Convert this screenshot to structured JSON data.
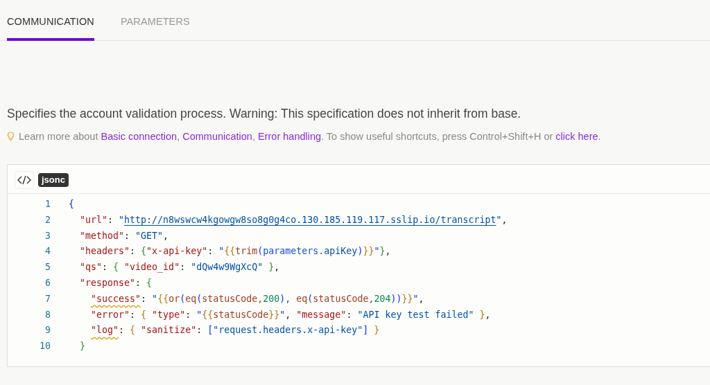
{
  "tabs": [
    {
      "label": "COMMUNICATION",
      "selected": true
    },
    {
      "label": "PARAMETERS",
      "selected": false
    }
  ],
  "description": "Specifies the account validation process. Warning: This specification does not inherit from base.",
  "tip": [
    {
      "kind": "text",
      "text": "Learn more about "
    },
    {
      "kind": "link",
      "text": "Basic connection"
    },
    {
      "kind": "text",
      "text": ", "
    },
    {
      "kind": "link",
      "text": "Communication"
    },
    {
      "kind": "text",
      "text": ", "
    },
    {
      "kind": "link",
      "text": "Error handling"
    },
    {
      "kind": "text",
      "text": ". To show useful shortcuts, press Control+Shift+H or "
    },
    {
      "kind": "link",
      "text": "click here"
    },
    {
      "kind": "text",
      "text": "."
    }
  ],
  "editor": {
    "language": "jsonc",
    "lines": [
      {
        "number": "1",
        "tokens": [
          {
            "kind": "b1",
            "text": "{"
          }
        ]
      },
      {
        "number": "2",
        "tokens": [
          {
            "kind": "key",
            "text": "  \"url\""
          },
          {
            "kind": "p",
            "text": ": "
          },
          {
            "kind": "str",
            "text": "\""
          },
          {
            "kind": "link",
            "text": "http://n8wswcw4kgowgw8so8g0g4co.130.185.119.117.sslip.io/transcript"
          },
          {
            "kind": "str",
            "text": "\""
          },
          {
            "kind": "p",
            "text": ","
          }
        ]
      },
      {
        "number": "3",
        "tokens": [
          {
            "kind": "key",
            "text": "  \"method\""
          },
          {
            "kind": "p",
            "text": ": "
          },
          {
            "kind": "str",
            "text": "\"GET\""
          },
          {
            "kind": "p",
            "text": ","
          }
        ]
      },
      {
        "number": "4",
        "tokens": [
          {
            "kind": "key",
            "text": "  \"headers\""
          },
          {
            "kind": "p",
            "text": ": "
          },
          {
            "kind": "b2",
            "text": "{"
          },
          {
            "kind": "key",
            "text": "\"x-api-key\""
          },
          {
            "kind": "p",
            "text": ": "
          },
          {
            "kind": "str",
            "text": "\""
          },
          {
            "kind": "b3",
            "text": "{{"
          },
          {
            "kind": "fn",
            "text": "trim"
          },
          {
            "kind": "b1",
            "text": "("
          },
          {
            "kind": "var",
            "text": "parameters"
          },
          {
            "kind": "str",
            "text": ".apiKey"
          },
          {
            "kind": "b1",
            "text": ")"
          },
          {
            "kind": "b3",
            "text": "}}"
          },
          {
            "kind": "str",
            "text": "\""
          },
          {
            "kind": "b2",
            "text": "}"
          },
          {
            "kind": "p",
            "text": ","
          }
        ]
      },
      {
        "number": "5",
        "tokens": [
          {
            "kind": "key",
            "text": "  \"qs\""
          },
          {
            "kind": "p",
            "text": ": "
          },
          {
            "kind": "b2",
            "text": "{ "
          },
          {
            "kind": "key",
            "text": "\"video_id\""
          },
          {
            "kind": "p",
            "text": ": "
          },
          {
            "kind": "str",
            "text": "\"dQw4w9WgXcQ\" "
          },
          {
            "kind": "b2",
            "text": "}"
          },
          {
            "kind": "p",
            "text": ","
          }
        ]
      },
      {
        "number": "6",
        "tokens": [
          {
            "kind": "key",
            "text": "  \"response\""
          },
          {
            "kind": "p",
            "text": ": "
          },
          {
            "kind": "b2",
            "text": "{"
          }
        ]
      },
      {
        "number": "7",
        "tokens": [
          {
            "kind": "key",
            "text": "    \"success\"",
            "warning": true
          },
          {
            "kind": "p",
            "text": ": "
          },
          {
            "kind": "str",
            "text": "\""
          },
          {
            "kind": "b3",
            "text": "{{"
          },
          {
            "kind": "fn",
            "text": "or"
          },
          {
            "kind": "b1",
            "text": "("
          },
          {
            "kind": "fn",
            "text": "eq"
          },
          {
            "kind": "b1",
            "text": "("
          },
          {
            "kind": "fn",
            "text": "statusCode,"
          },
          {
            "kind": "num",
            "text": "200"
          },
          {
            "kind": "b1",
            "text": ")"
          },
          {
            "kind": "str",
            "text": ", "
          },
          {
            "kind": "fn",
            "text": "eq"
          },
          {
            "kind": "b1",
            "text": "("
          },
          {
            "kind": "fn",
            "text": "statusCode,"
          },
          {
            "kind": "num",
            "text": "204"
          },
          {
            "kind": "b1",
            "text": "))"
          },
          {
            "kind": "b3",
            "text": "}}"
          },
          {
            "kind": "str",
            "text": "\""
          },
          {
            "kind": "p",
            "text": ","
          }
        ]
      },
      {
        "number": "8",
        "tokens": [
          {
            "kind": "key",
            "text": "    \"error\""
          },
          {
            "kind": "p",
            "text": ": "
          },
          {
            "kind": "b3",
            "text": "{ "
          },
          {
            "kind": "key",
            "text": "\"type\""
          },
          {
            "kind": "p",
            "text": ": "
          },
          {
            "kind": "str",
            "text": "\""
          },
          {
            "kind": "b3",
            "text": "{{"
          },
          {
            "kind": "fn",
            "text": "statusCode"
          },
          {
            "kind": "b3",
            "text": "}}"
          },
          {
            "kind": "str",
            "text": "\""
          },
          {
            "kind": "p",
            "text": ", "
          },
          {
            "kind": "key",
            "text": "\"message\""
          },
          {
            "kind": "p",
            "text": ": "
          },
          {
            "kind": "str",
            "text": "\"API key test failed\" "
          },
          {
            "kind": "b3",
            "text": "}"
          },
          {
            "kind": "p",
            "text": ","
          }
        ]
      },
      {
        "number": "9",
        "tokens": [
          {
            "kind": "key",
            "text": "    \"log\"",
            "warning": true
          },
          {
            "kind": "p",
            "text": ": "
          },
          {
            "kind": "b3",
            "text": "{ "
          },
          {
            "kind": "key",
            "text": "\"sanitize\""
          },
          {
            "kind": "p",
            "text": ": "
          },
          {
            "kind": "b4",
            "text": "["
          },
          {
            "kind": "str",
            "text": "\"request.headers.x-api-key\""
          },
          {
            "kind": "b4",
            "text": "] "
          },
          {
            "kind": "b3",
            "text": "}"
          }
        ]
      },
      {
        "number": "10",
        "tokens": [
          {
            "kind": "b2",
            "text": "  }"
          }
        ]
      }
    ]
  }
}
